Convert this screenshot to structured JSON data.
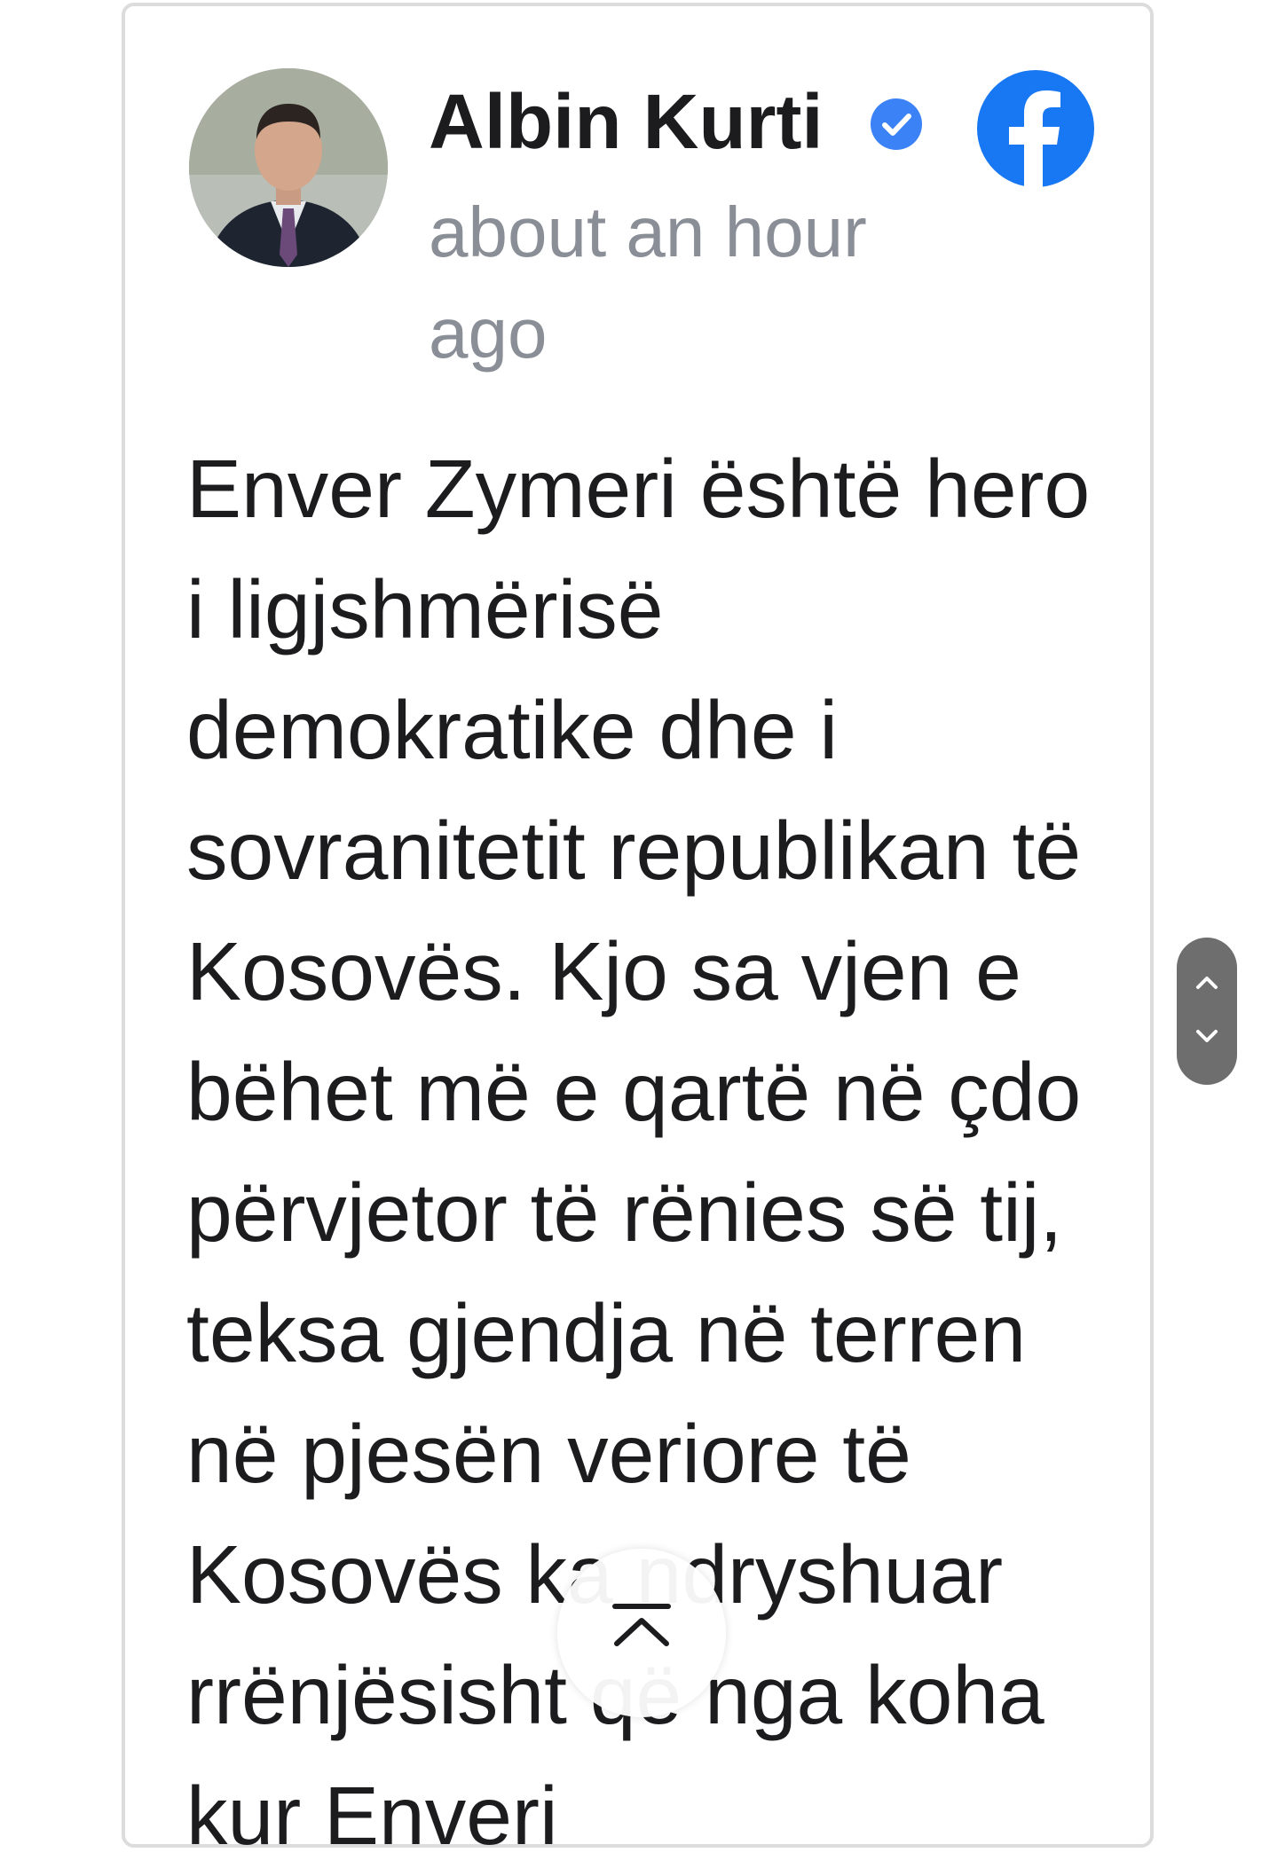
{
  "post": {
    "author": "Albin Kurti",
    "timestamp": "about an hour ago",
    "text": "Enver Zymeri është hero i ligjshmërisë demokratike dhe i sovranitetit republikan të Kosovës. Kjo sa vjen e bëhet më e qartë në çdo përvjetor të rënies së tij, teksa gjendja në terren në pjesën veriore të Kosovës ka ndryshuar rrënjësisht që nga koha kur Enveri"
  },
  "icons": {
    "verified": "verified-badge-icon",
    "source": "facebook-icon",
    "scroll_up": "chevron-up-icon",
    "scroll_down": "chevron-down-icon",
    "back_to_top": "back-to-top-icon"
  },
  "colors": {
    "facebook_blue": "#1877f2",
    "verified_blue": "#3b82f6",
    "timestamp_gray": "#8a8e97",
    "text": "#1c1c1e",
    "scroll_control": "#6e6e6e"
  }
}
